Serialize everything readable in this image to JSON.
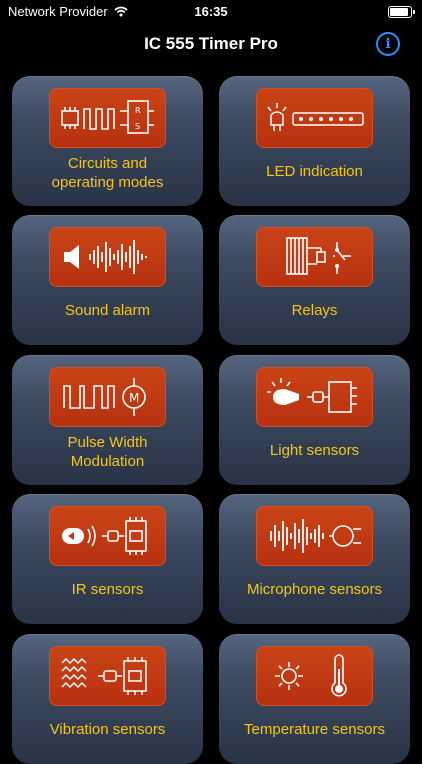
{
  "status": {
    "carrier": "Network Provider",
    "time": "16:35"
  },
  "header": {
    "title": "IC 555 Timer Pro",
    "info_icon": "info-circle-icon"
  },
  "colors": {
    "accent_text": "#f4c613",
    "icon_bg": "#bf3a10",
    "info": "#2f8dff"
  },
  "cards": [
    {
      "label_line1": "Circuits and",
      "label_line2": "operating modes",
      "icon": "circuit-modes-icon"
    },
    {
      "label_line1": "LED indication",
      "label_line2": "",
      "icon": "led-strip-icon"
    },
    {
      "label_line1": "Sound alarm",
      "label_line2": "",
      "icon": "speaker-waveform-icon"
    },
    {
      "label_line1": "Relays",
      "label_line2": "",
      "icon": "relay-icon"
    },
    {
      "label_line1": "Pulse Width",
      "label_line2": "Modulation",
      "icon": "pwm-motor-icon"
    },
    {
      "label_line1": "Light sensors",
      "label_line2": "",
      "icon": "light-sensor-icon"
    },
    {
      "label_line1": "IR sensors",
      "label_line2": "",
      "icon": "ir-sensor-icon"
    },
    {
      "label_line1": "Microphone sensors",
      "label_line2": "",
      "icon": "microphone-sensor-icon"
    },
    {
      "label_line1": "Vibration sensors",
      "label_line2": "",
      "icon": "vibration-sensor-icon"
    },
    {
      "label_line1": "Temperature sensors",
      "label_line2": "",
      "icon": "temperature-sensor-icon"
    }
  ]
}
